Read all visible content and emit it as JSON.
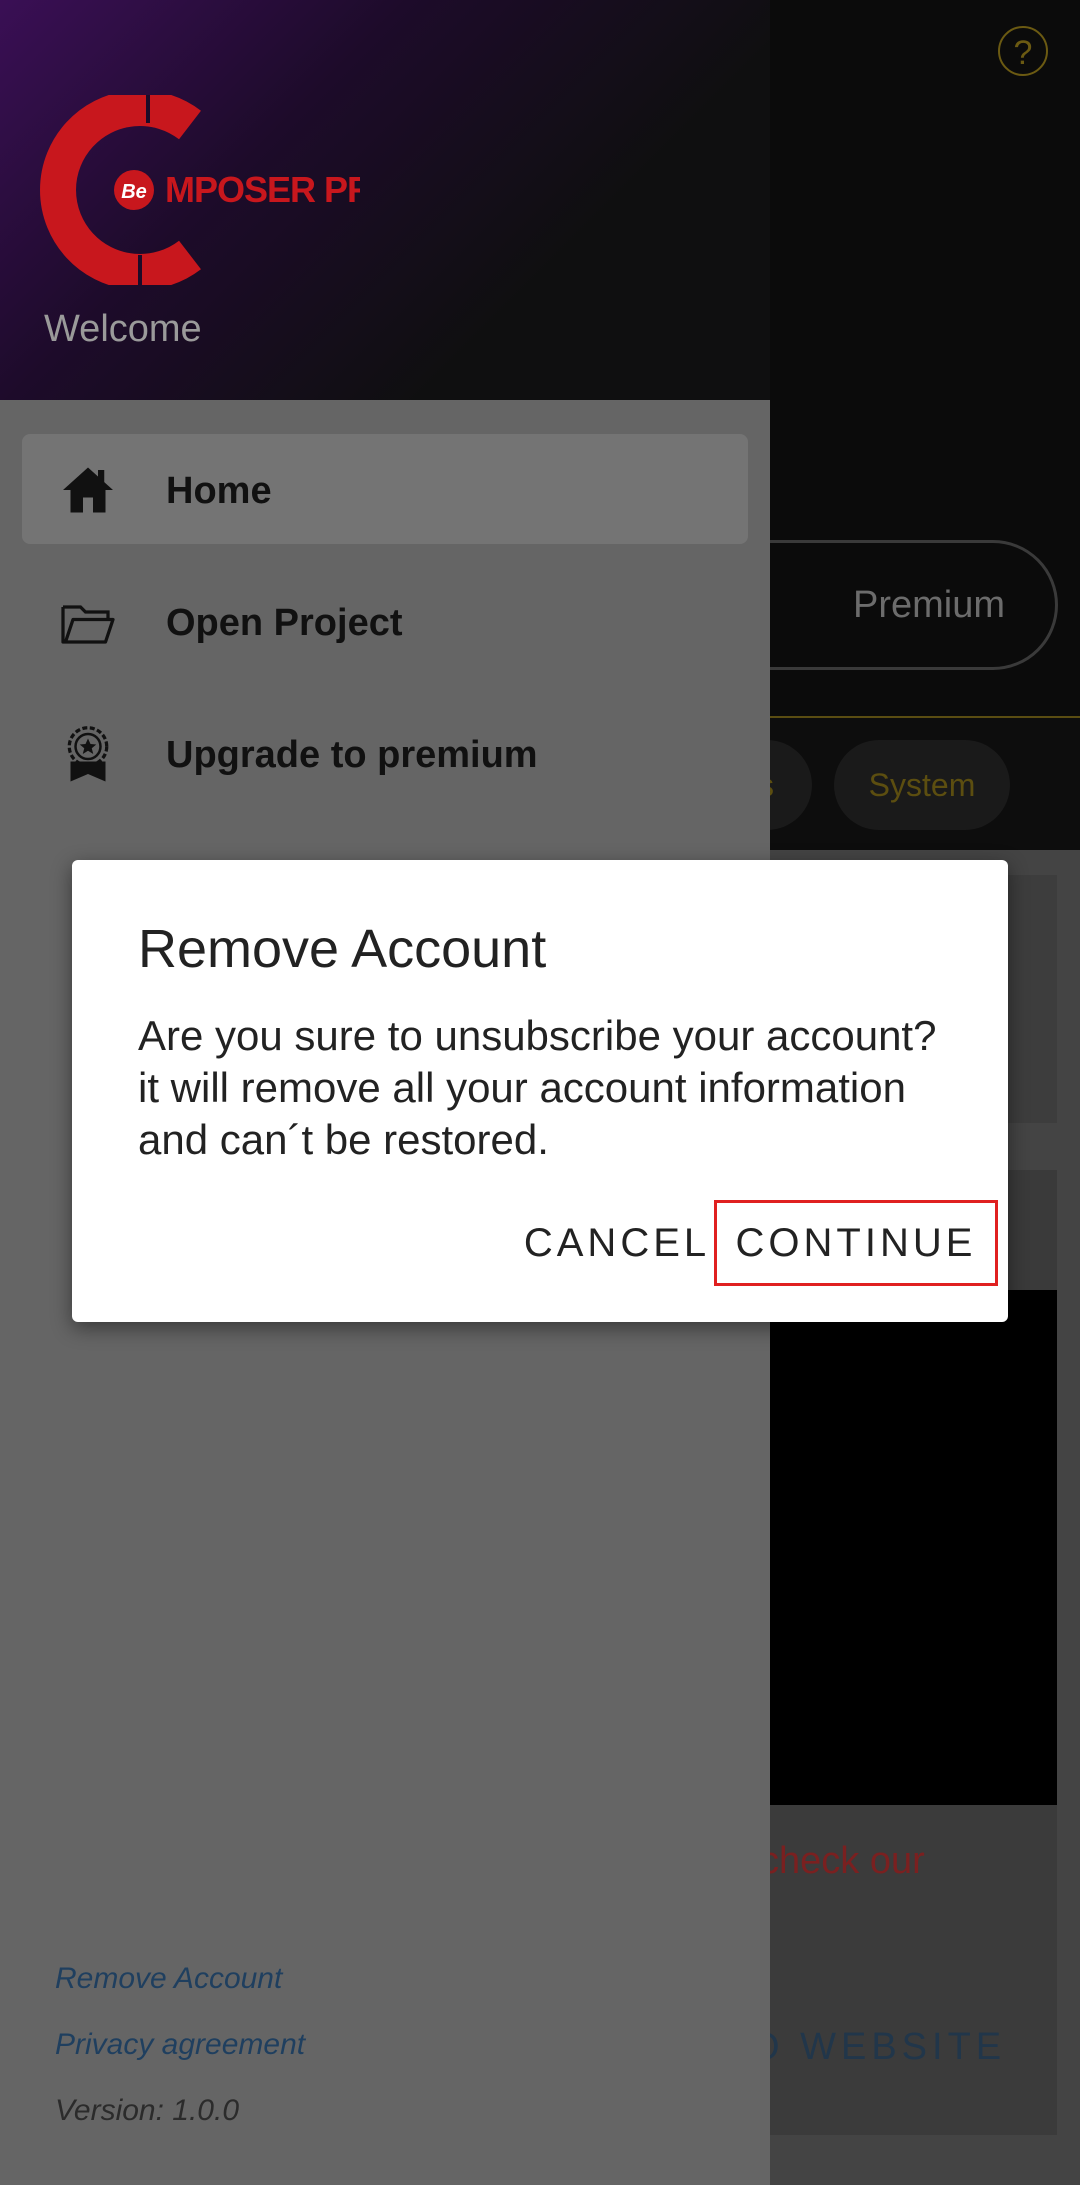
{
  "background": {
    "premium_label": "Premium",
    "chip_partial": "s",
    "chip_system": "System",
    "check_text": "check our",
    "website_text": "O WEBSITE"
  },
  "drawer": {
    "logo_text": "MPOSER PRO",
    "logo_badge": "Be",
    "welcome": "Welcome",
    "items": [
      {
        "label": "Home",
        "icon": "home-icon",
        "active": true
      },
      {
        "label": "Open Project",
        "icon": "folder-icon",
        "active": false
      },
      {
        "label": "Upgrade to premium",
        "icon": "premium-badge-icon",
        "active": false
      }
    ],
    "footer": {
      "remove_account": "Remove Account",
      "privacy": "Privacy agreement",
      "version": "Version: 1.0.0"
    }
  },
  "dialog": {
    "title": "Remove Account",
    "message": "Are you sure to unsubscribe your account? it will remove all your account information and can´t be restored.",
    "cancel_label": "CANCEL",
    "continue_label": "CONTINUE"
  },
  "colors": {
    "accent_gold": "#6b5a12",
    "logo_red": "#c8171d",
    "highlight_border": "#e02020"
  }
}
